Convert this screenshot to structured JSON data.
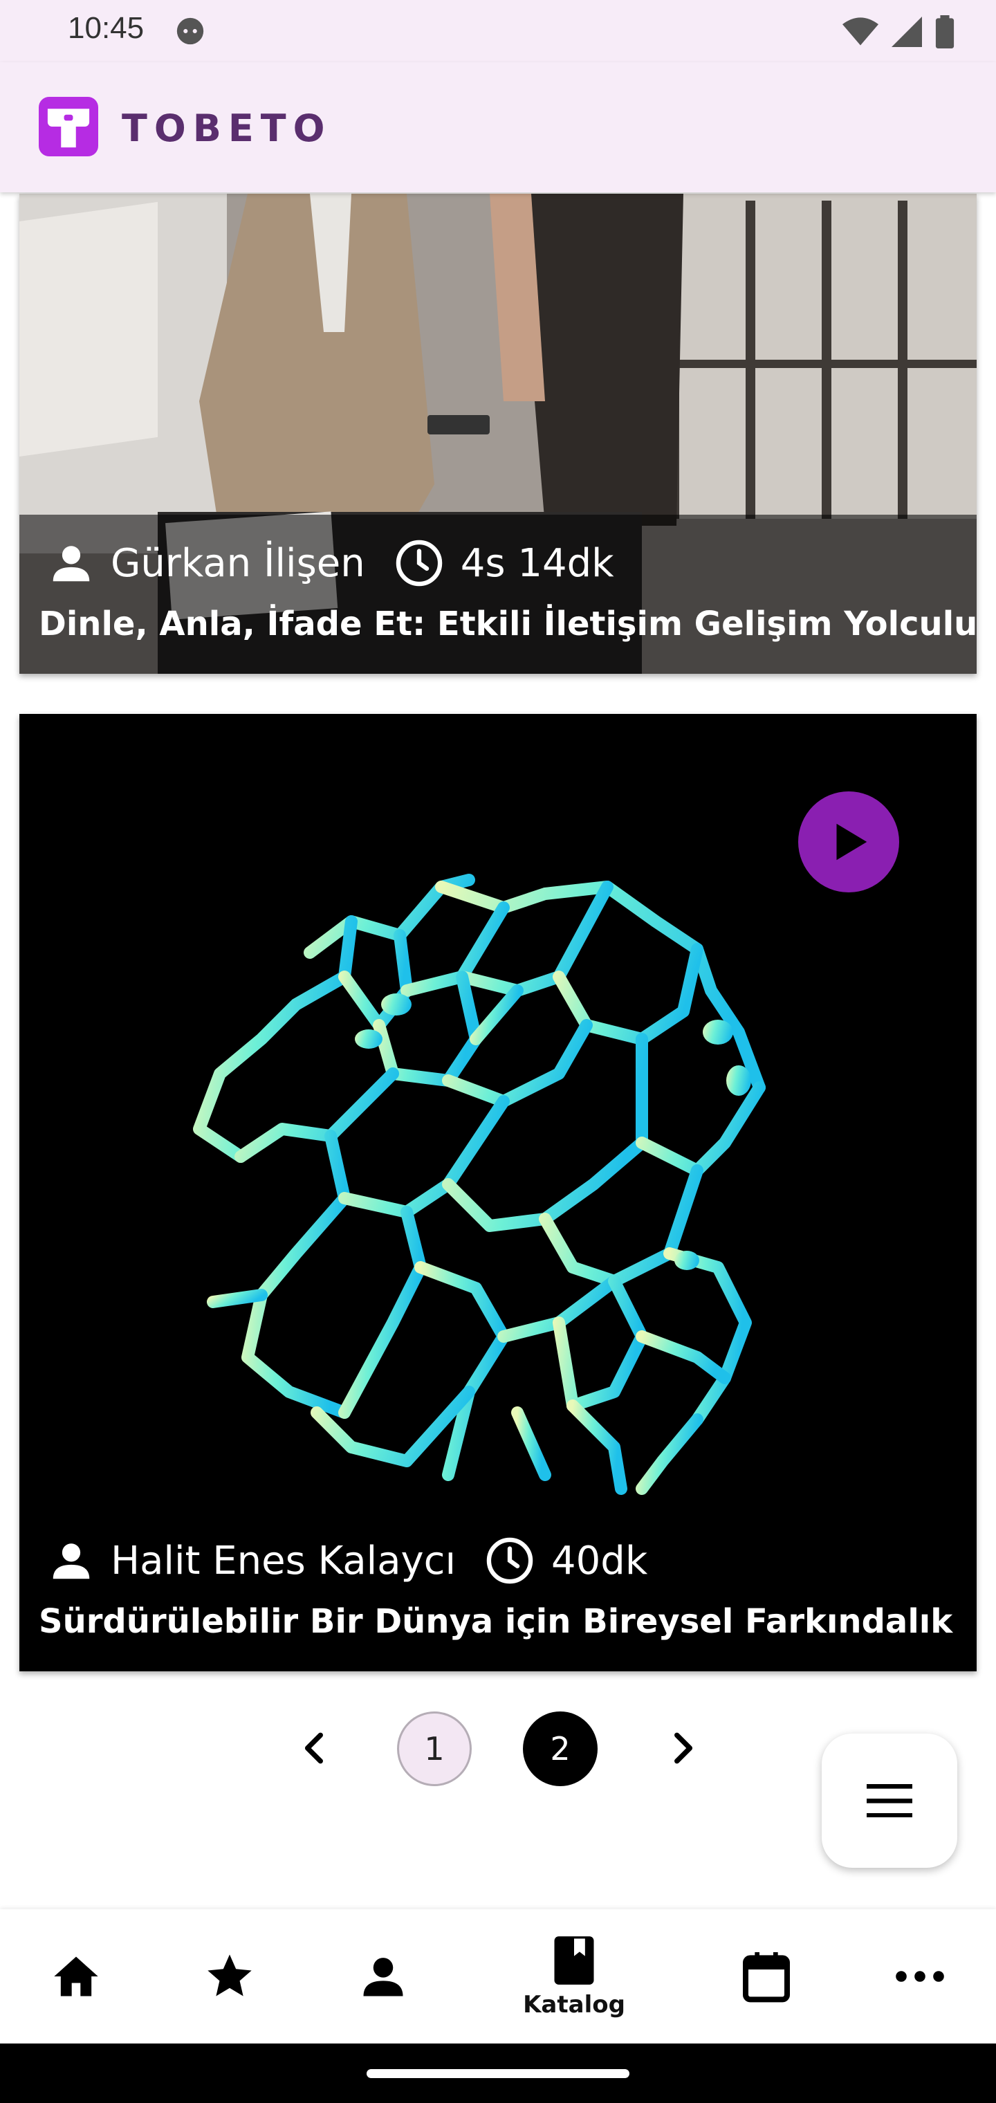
{
  "status_bar": {
    "time": "10:45"
  },
  "app_bar": {
    "logo_text": "TOBETO"
  },
  "cards": [
    {
      "instructor": "Gürkan İlişen",
      "duration": "4s 14dk",
      "title": "Dinle, Anla, İfade Et: Etkili İletişim Gelişim Yolculuğu"
    },
    {
      "instructor": "Halit Enes Kalaycı",
      "duration": "40dk",
      "title": "Sürdürülebilir Bir Dünya için Bireysel Farkındalık"
    }
  ],
  "pagination": {
    "pages": [
      "1",
      "2"
    ],
    "current": "2"
  },
  "bottom_nav": {
    "items": [
      {
        "icon": "home-icon"
      },
      {
        "icon": "star-icon"
      },
      {
        "icon": "person-icon"
      },
      {
        "icon": "book-icon",
        "label": "Katalog"
      },
      {
        "icon": "calendar-icon"
      },
      {
        "icon": "more-icon"
      }
    ]
  },
  "colors": {
    "accent": "#8a1fb1",
    "header_bg": "#f7ecf8"
  }
}
